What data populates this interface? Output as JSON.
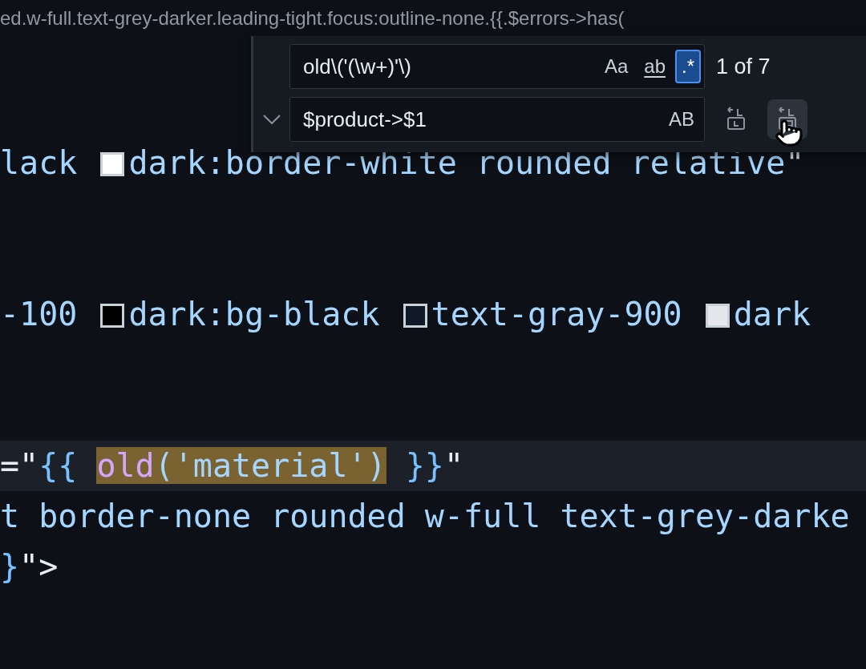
{
  "breadcrumb": "ed.w-full.text-grey-darker.leading-tight.focus:outline-none.{{.$errors->has(",
  "find_widget": {
    "expanded": true,
    "find": {
      "value": "old\\('(\\w+)'\\)",
      "options": [
        {
          "label": "Aa",
          "kind": "case",
          "selected": false
        },
        {
          "label": "ab",
          "kind": "word",
          "selected": false
        },
        {
          "label": ".*",
          "kind": "regex",
          "selected": true
        }
      ],
      "match_count": "1 of 7"
    },
    "replace": {
      "value": "$product->$1",
      "options": [
        {
          "label": "AB",
          "kind": "preserve-case",
          "selected": false
        }
      ]
    },
    "buttons": [
      {
        "kind": "replace",
        "hovered": false
      },
      {
        "kind": "replace-all",
        "hovered": true
      }
    ]
  },
  "code_lines": [
    {
      "current": false,
      "tokens": [
        {
          "text": "lack ",
          "kind": "attr"
        },
        {
          "kind": "swatch",
          "color": "#ffffff"
        },
        {
          "text": "dark:border-white rounded relative",
          "kind": "attr"
        },
        {
          "text": "\"",
          "kind": "punct"
        }
      ]
    },
    {
      "current": false
    },
    {
      "current": false
    },
    {
      "current": false,
      "tokens": [
        {
          "text": "-100 ",
          "kind": "attr"
        },
        {
          "kind": "swatch",
          "color": "#000000"
        },
        {
          "text": "dark:bg-black ",
          "kind": "attr"
        },
        {
          "kind": "swatch",
          "color": "#111827"
        },
        {
          "text": "text-gray-900 ",
          "kind": "attr"
        },
        {
          "kind": "swatch",
          "color": "#e5e7eb"
        },
        {
          "text": "dark",
          "kind": "attr"
        }
      ]
    },
    {
      "current": false
    },
    {
      "current": false
    },
    {
      "current": true,
      "tokens": [
        {
          "text": "=\"",
          "kind": "punct"
        },
        {
          "text": "{{ ",
          "kind": "brace"
        },
        {
          "text": "old",
          "kind": "func",
          "match": true
        },
        {
          "text": "('material')",
          "kind": "attr",
          "match": true
        },
        {
          "text": " }}",
          "kind": "brace"
        },
        {
          "text": "\"",
          "kind": "punct"
        }
      ]
    },
    {
      "current": false,
      "tokens": [
        {
          "text": "t border-none rounded w-full text-grey-darke",
          "kind": "attr"
        }
      ]
    },
    {
      "current": false,
      "tokens": [
        {
          "text": "}",
          "kind": "brace"
        },
        {
          "text": "\">",
          "kind": "punct"
        }
      ]
    }
  ]
}
